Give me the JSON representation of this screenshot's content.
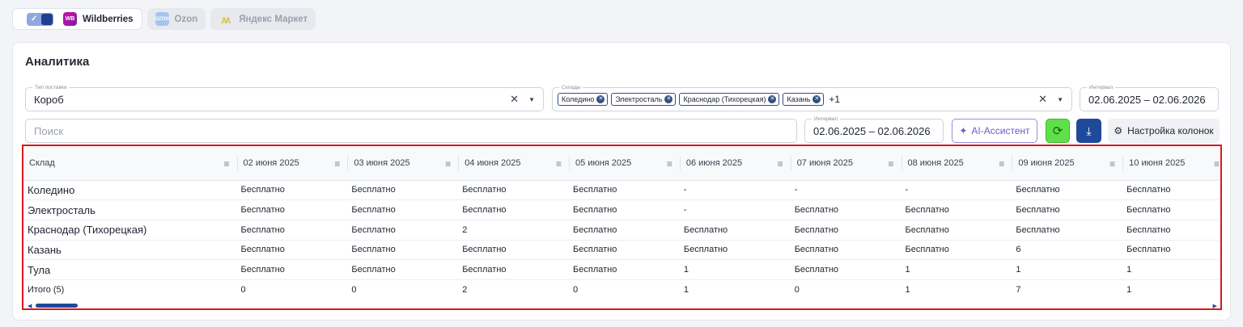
{
  "marketplaces": [
    {
      "label": "Wildberries",
      "logo": "WB",
      "active": true
    },
    {
      "label": "Ozon",
      "logo": "OZON",
      "active": false
    },
    {
      "label": "Яндекс Маркет",
      "logo": "YM",
      "active": false
    }
  ],
  "toggle": {
    "checked": true
  },
  "card": {
    "title": "Аналитика"
  },
  "filters": {
    "supply_type": {
      "label": "Тип поставки",
      "value": "Короб"
    },
    "warehouses": {
      "label": "Склады",
      "chips": [
        "Коледино",
        "Электросталь",
        "Краснодар (Тихорецкая)",
        "Казань"
      ],
      "more": "+1"
    },
    "interval_top": {
      "label": "Интервал",
      "value": "02.06.2025 – 02.06.2026"
    },
    "search": {
      "placeholder": "Поиск"
    },
    "interval": {
      "label": "Интервал",
      "value": "02.06.2025 – 02.06.2026"
    }
  },
  "buttons": {
    "ai": "AI-Ассистент",
    "columns": "Настройка колонок"
  },
  "icons": {
    "clear": "✕",
    "caret": "▼",
    "refresh": "⟳",
    "download": "⤓",
    "gear": "⚙",
    "sparkle": "✦",
    "menu": "≡",
    "check": "✓"
  },
  "table": {
    "columns": [
      "Склад",
      "02 июня 2025",
      "03 июня 2025",
      "04 июня 2025",
      "05 июня 2025",
      "06 июня 2025",
      "07 июня 2025",
      "08 июня 2025",
      "09 июня 2025",
      "10 июня 2025"
    ],
    "rows": [
      {
        "name": "Коледино",
        "values": [
          "Бесплатно",
          "Бесплатно",
          "Бесплатно",
          "Бесплатно",
          "-",
          "-",
          "-",
          "Бесплатно",
          "Бесплатно"
        ]
      },
      {
        "name": "Электросталь",
        "values": [
          "Бесплатно",
          "Бесплатно",
          "Бесплатно",
          "Бесплатно",
          "-",
          "Бесплатно",
          "Бесплатно",
          "Бесплатно",
          "Бесплатно"
        ]
      },
      {
        "name": "Краснодар (Тихорецкая)",
        "values": [
          "Бесплатно",
          "Бесплатно",
          "2",
          "Бесплатно",
          "Бесплатно",
          "Бесплатно",
          "Бесплатно",
          "Бесплатно",
          "Бесплатно"
        ]
      },
      {
        "name": "Казань",
        "values": [
          "Бесплатно",
          "Бесплатно",
          "Бесплатно",
          "Бесплатно",
          "Бесплатно",
          "Бесплатно",
          "Бесплатно",
          "6",
          "Бесплатно"
        ]
      },
      {
        "name": "Тула",
        "values": [
          "Бесплатно",
          "Бесплатно",
          "Бесплатно",
          "Бесплатно",
          "1",
          "Бесплатно",
          "1",
          "1",
          "1"
        ]
      }
    ],
    "total": {
      "name": "Итого (5)",
      "values": [
        "0",
        "0",
        "2",
        "0",
        "1",
        "0",
        "1",
        "7",
        "1"
      ]
    }
  },
  "colors": {
    "accent": "#1f4a9a",
    "highlight": "#d8181f",
    "refresh": "#5fe04a",
    "ai": "#6a5bc4"
  }
}
